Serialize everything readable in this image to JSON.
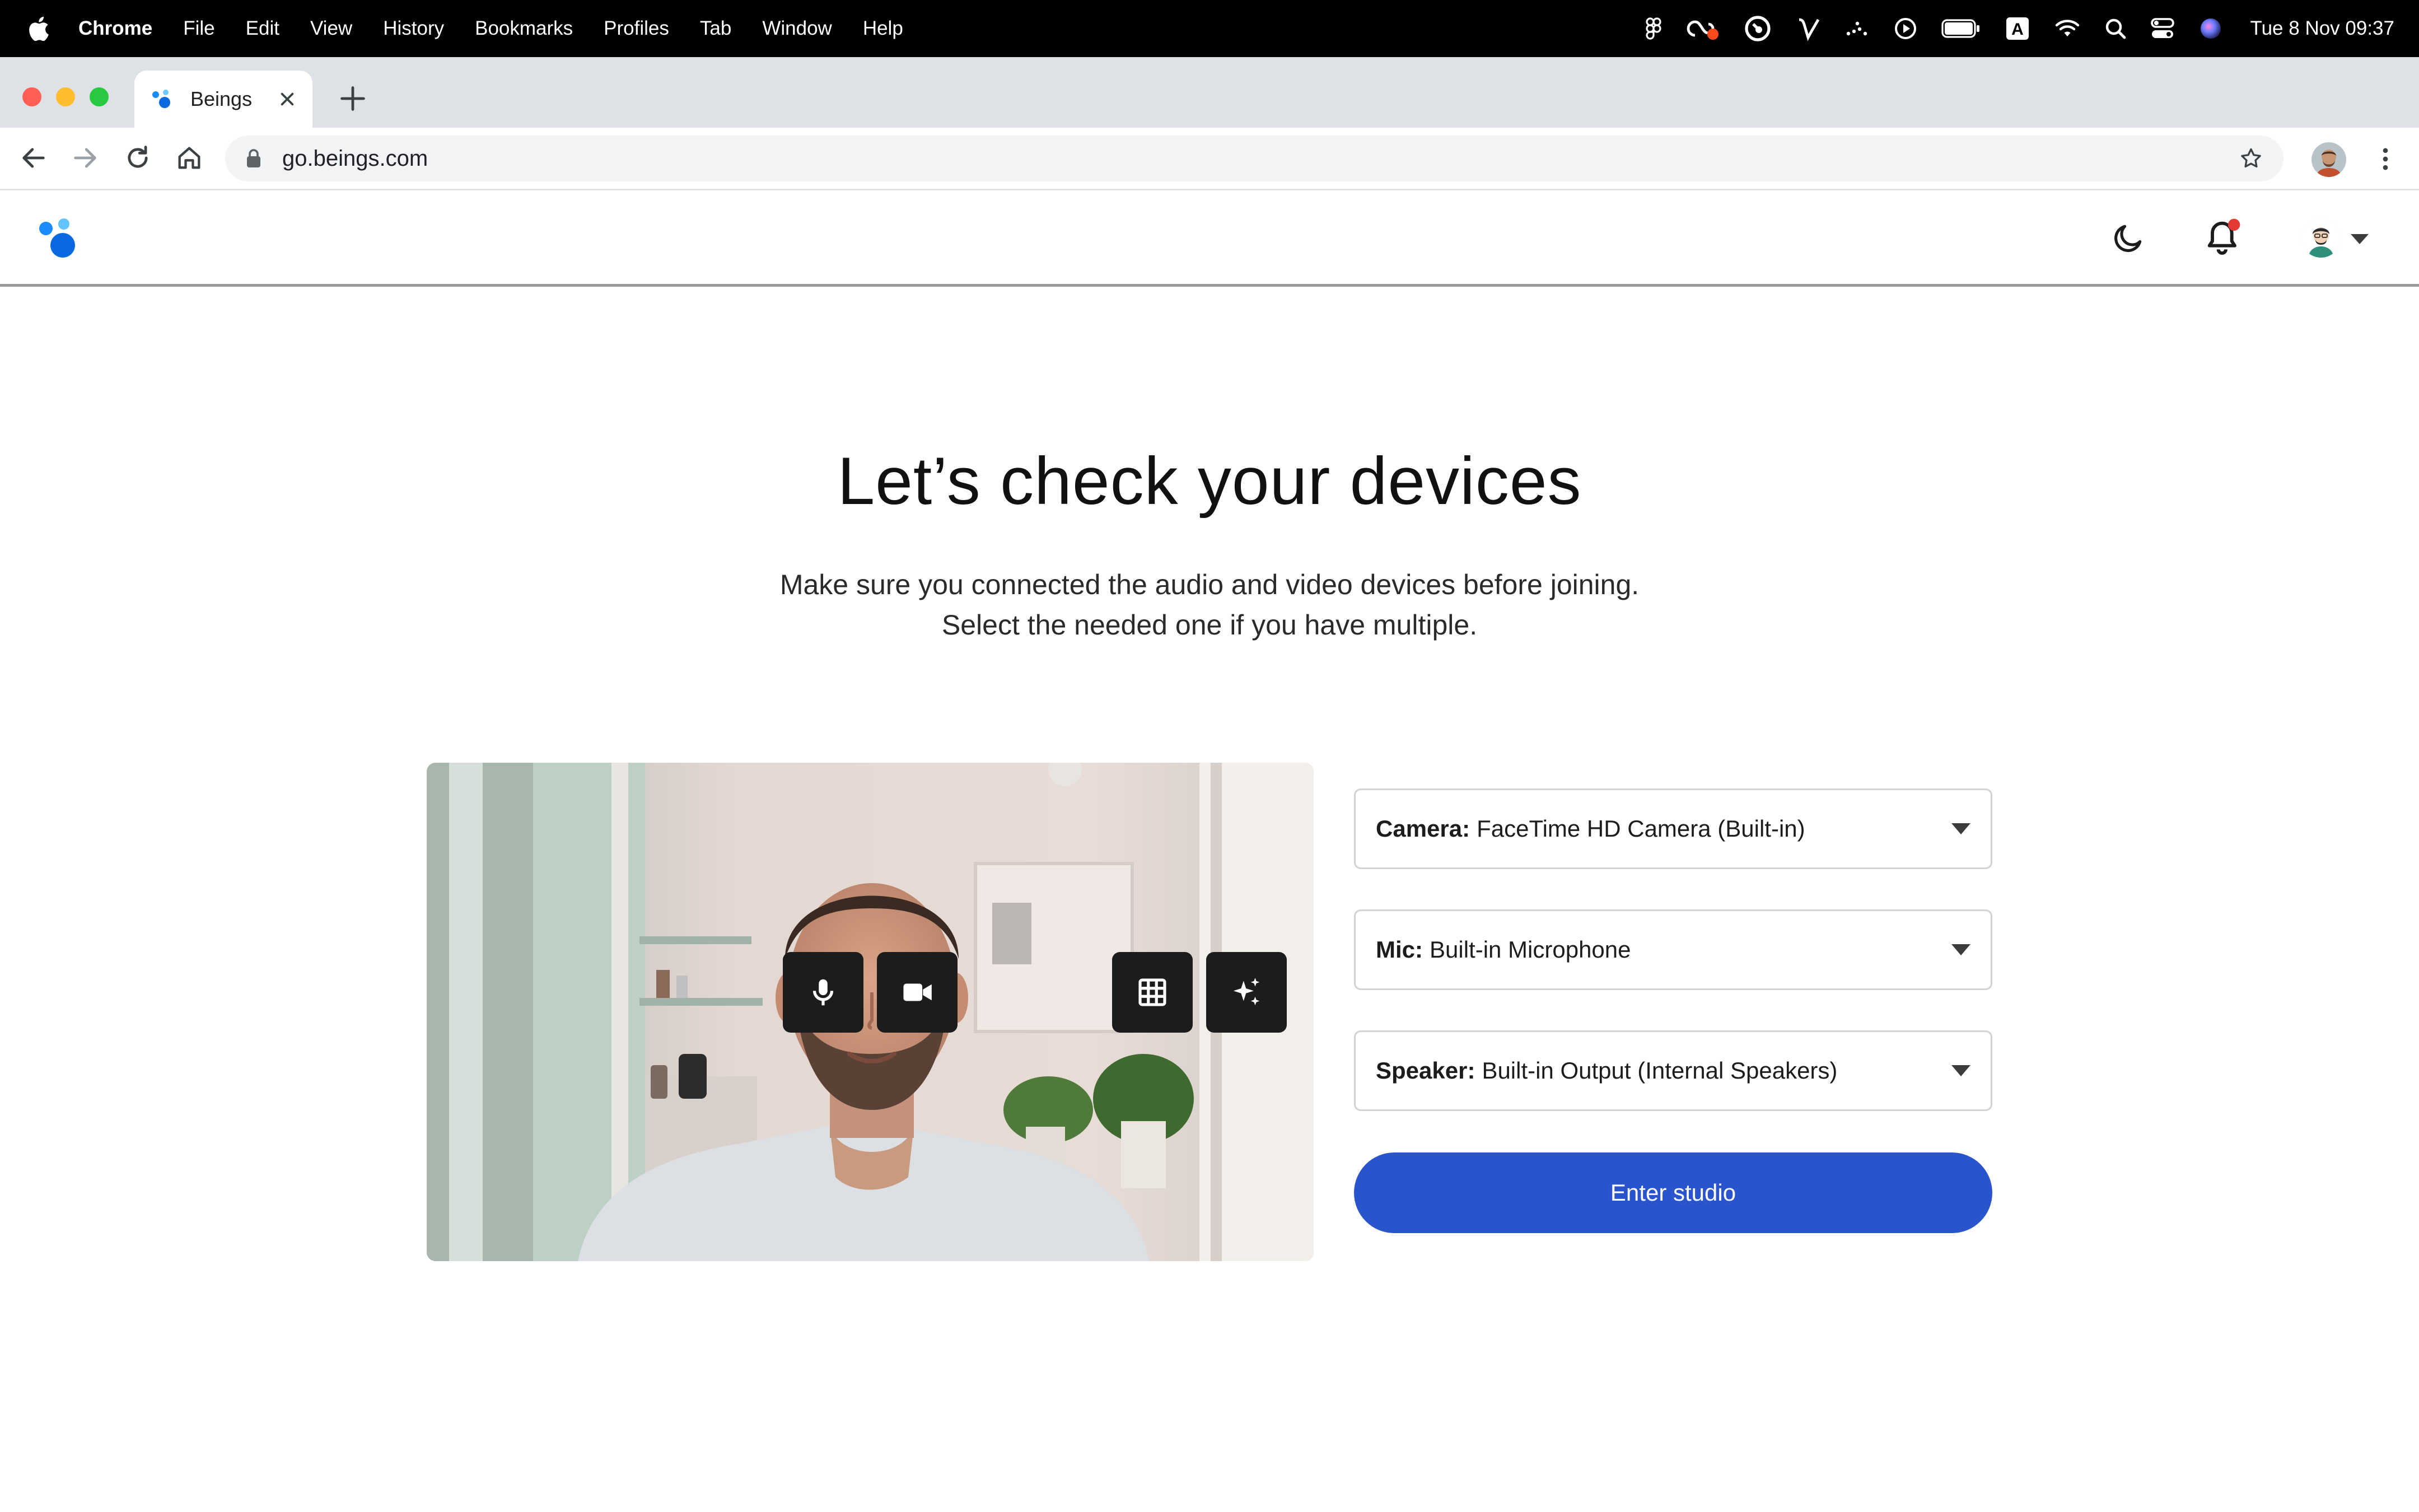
{
  "menubar": {
    "app_name": "Chrome",
    "items": [
      "File",
      "Edit",
      "View",
      "History",
      "Bookmarks",
      "Profiles",
      "Tab",
      "Window",
      "Help"
    ],
    "tray_icons": [
      "figma-icon",
      "creative-cloud-icon",
      "clockify-icon",
      "vectorworks-icon",
      "dots-icon",
      "play-icon",
      "battery-icon",
      "input-source-icon",
      "wifi-icon",
      "spotlight-icon",
      "control-center-icon",
      "siri-icon"
    ],
    "input_source": "A",
    "clock": "Tue 8 Nov  09:37"
  },
  "browser": {
    "tab_title": "Beings",
    "url": "go.beings.com"
  },
  "app": {
    "heading": "Let’s check your devices",
    "subtitle_line1": "Make sure you connected the audio and video devices before joining.",
    "subtitle_line2": "Select the needed one if you have multiple.",
    "camera": {
      "label": "Camera:",
      "value": "FaceTime HD Camera (Built-in)"
    },
    "mic": {
      "label": "Mic:",
      "value": "Built-in Microphone"
    },
    "speaker": {
      "label": "Speaker:",
      "value": "Built-in Output (Internal Speakers)"
    },
    "enter_label": "Enter studio",
    "preview_controls": [
      "microphone-icon",
      "video-camera-icon",
      "grid-layout-icon",
      "sparkle-effects-icon"
    ]
  },
  "colors": {
    "accent": "#2a54cc",
    "brand_blue": "#1a8cff",
    "notification_dot": "#e53935"
  }
}
